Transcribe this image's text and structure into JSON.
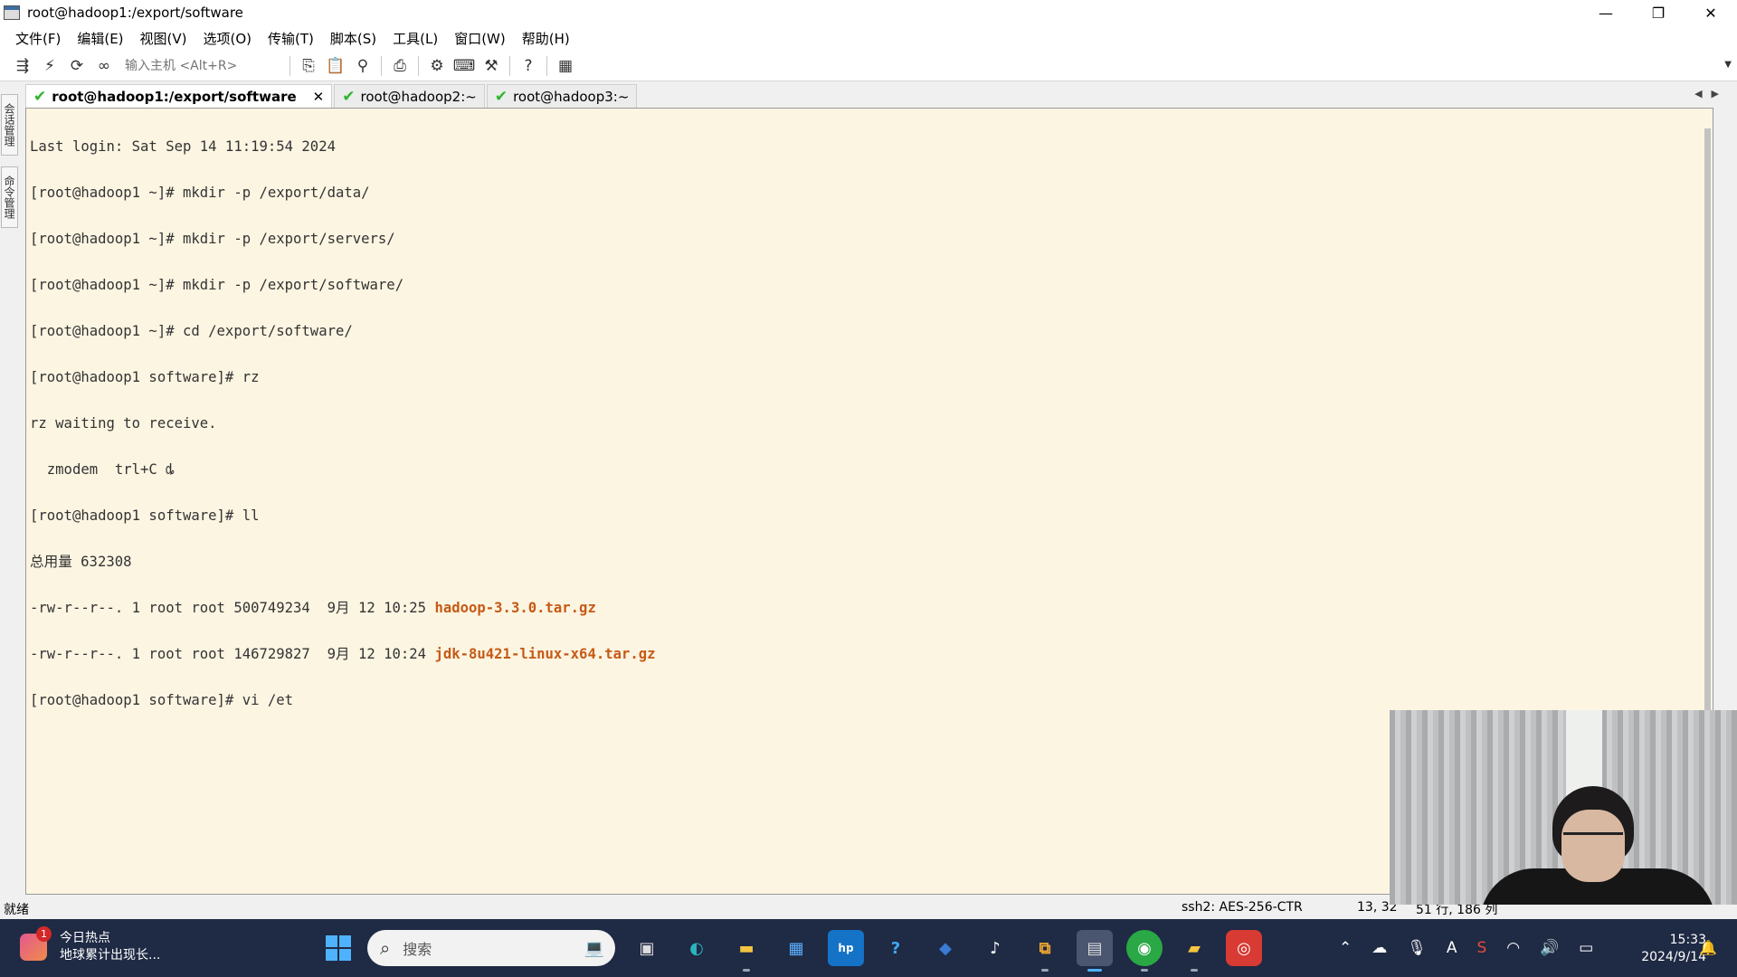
{
  "window": {
    "title": "root@hadoop1:/export/software",
    "controls": [
      "—",
      "❐",
      "✕"
    ]
  },
  "menu": [
    "文件(F)",
    "编辑(E)",
    "视图(V)",
    "选项(O)",
    "传输(T)",
    "脚本(S)",
    "工具(L)",
    "窗口(W)",
    "帮助(H)"
  ],
  "toolbar": {
    "host_placeholder": "输入主机 <Alt+R>",
    "icons_left": [
      "connect-icon",
      "quick-connect-icon",
      "reconnect-icon",
      "link-icon"
    ],
    "icons_right": [
      "copy-icon",
      "paste-icon",
      "find-icon",
      "print-icon",
      "settings-icon",
      "keymap-icon",
      "tool-icon",
      "help-icon",
      "map-icon"
    ]
  },
  "side_tabs": [
    "会话管理",
    "命令管理"
  ],
  "tabs": [
    {
      "label": "root@hadoop1:/export/software",
      "active": true
    },
    {
      "label": "root@hadoop2:~",
      "active": false
    },
    {
      "label": "root@hadoop3:~",
      "active": false
    }
  ],
  "terminal": {
    "lines": [
      "Last login: Sat Sep 14 11:19:54 2024",
      "[root@hadoop1 ~]# mkdir -p /export/data/",
      "[root@hadoop1 ~]# mkdir -p /export/servers/",
      "[root@hadoop1 ~]# mkdir -p /export/software/",
      "[root@hadoop1 ~]# cd /export/software/",
      "[root@hadoop1 software]# rz",
      "rz waiting to receive.",
      "  zmodem  trl+C ȡ",
      "[root@hadoop1 software]# ll",
      "总用量 632308"
    ],
    "files": [
      {
        "meta": "-rw-r--r--. 1 root root 500749234  9月 12 10:25 ",
        "name": "hadoop-3.3.0.tar.gz"
      },
      {
        "meta": "-rw-r--r--. 1 root root 146729827  9月 12 10:24 ",
        "name": "jdk-8u421-linux-x64.tar.gz"
      }
    ],
    "last_line": "[root@hadoop1 software]# vi /et"
  },
  "status": {
    "ready": "就绪",
    "cipher": "ssh2: AES-256-CTR",
    "cursor": "13,  32",
    "size": "51 行, 186 列"
  },
  "taskbar": {
    "news_title": "今日热点",
    "news_sub": "地球累计出现长...",
    "news_badge": "1",
    "search_label": "搜索",
    "apps": [
      "files-icon",
      "edge-icon",
      "explorer-icon",
      "store-icon",
      "myhp-icon",
      "help-app-icon",
      "azure-icon",
      "tiktok-icon",
      "vm-icon",
      "securecrt-icon",
      "wechat-icon",
      "folder-icon",
      "chrome-icon"
    ],
    "tray_icons": [
      "chevron-up-icon",
      "cloud-icon",
      "mic-icon",
      "ime-icon",
      "sogou-icon",
      "wifi-icon",
      "volume-icon",
      "battery-icon"
    ],
    "tray_ime": "A",
    "time": "15:33",
    "date": "2024/9/14"
  }
}
